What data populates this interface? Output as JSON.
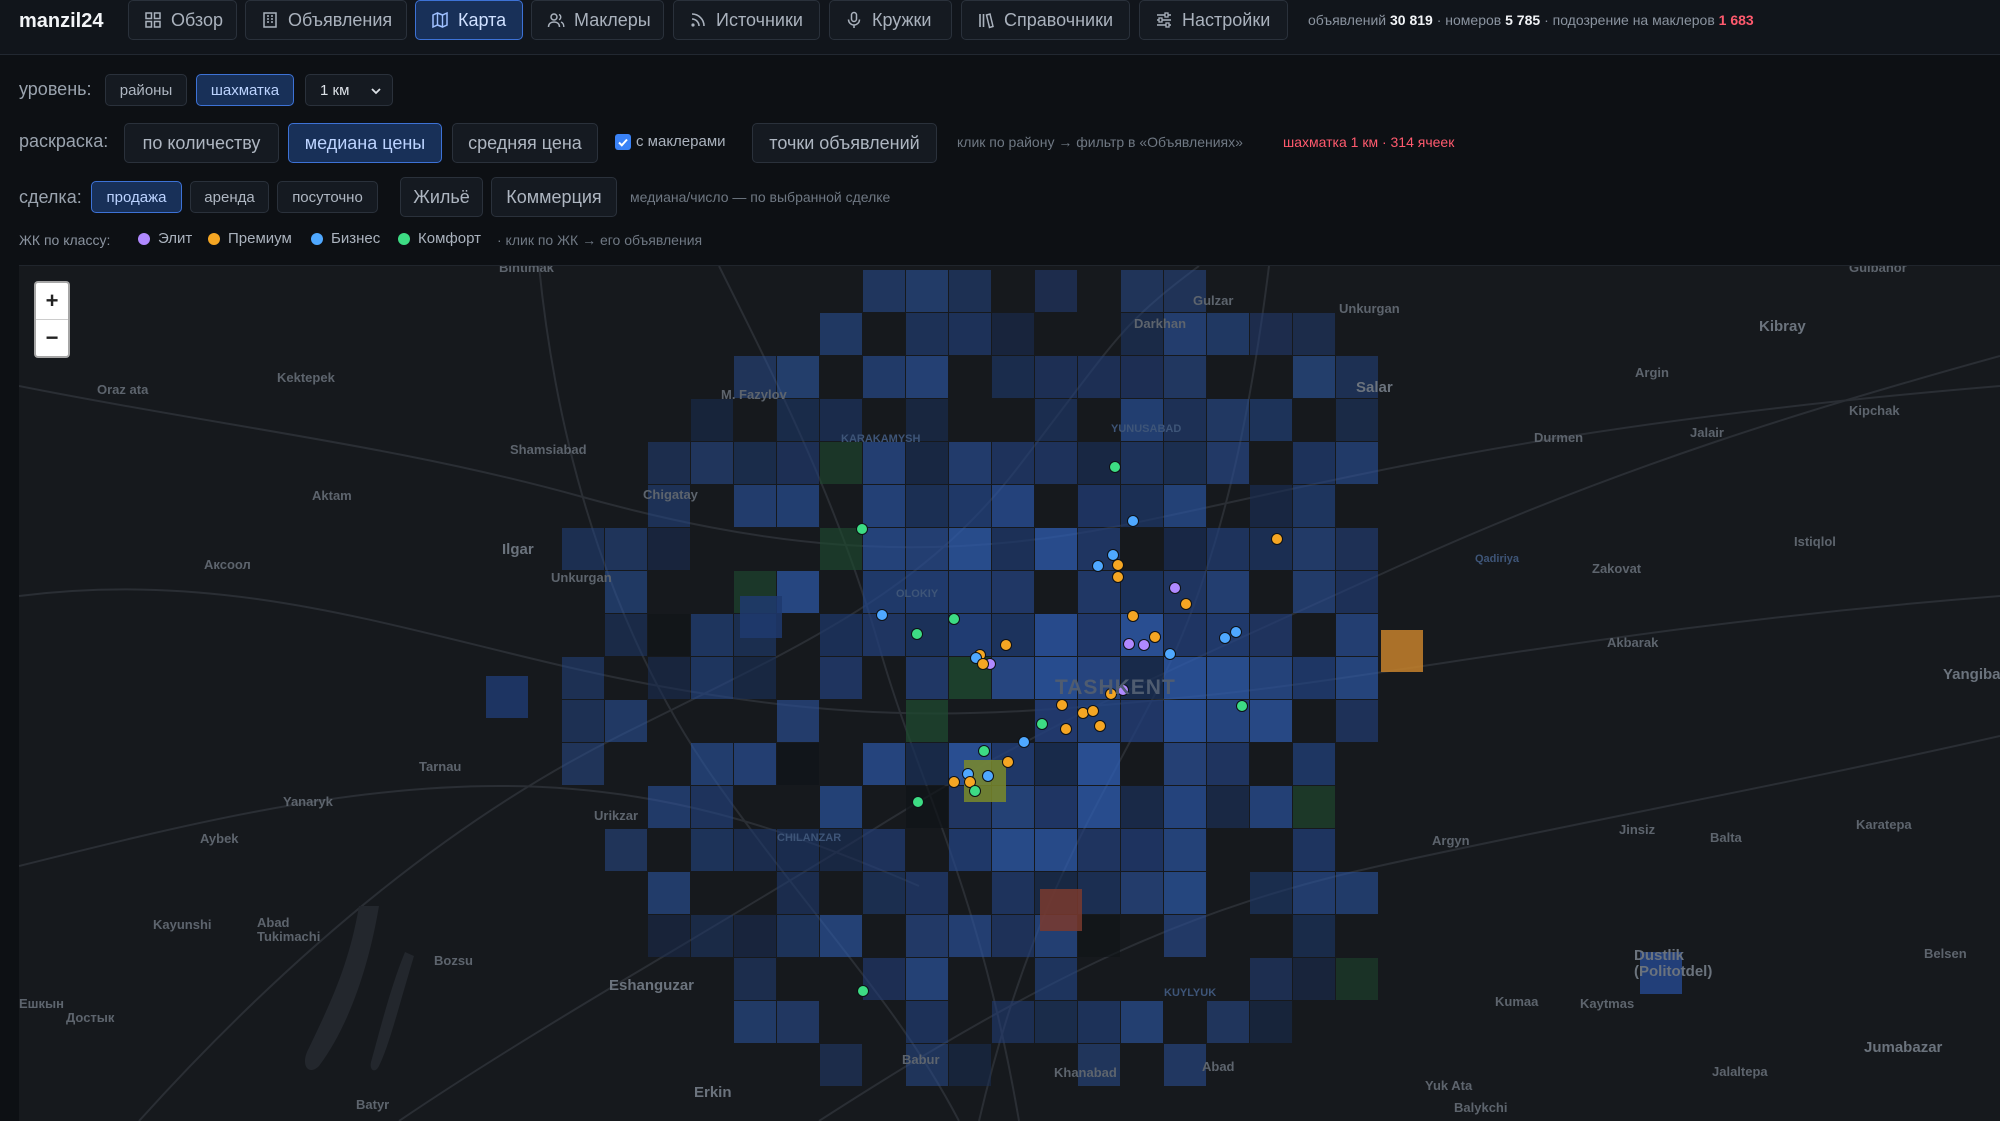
{
  "app": {
    "name": "manzil24"
  },
  "nav": [
    {
      "label": "Обзор",
      "icon": "grid-icon",
      "active": false
    },
    {
      "label": "Объявления",
      "icon": "building-icon",
      "active": false
    },
    {
      "label": "Карта",
      "icon": "map-icon",
      "active": true
    },
    {
      "label": "Маклеры",
      "icon": "users-icon",
      "active": false
    },
    {
      "label": "Источники",
      "icon": "rss-icon",
      "active": false
    },
    {
      "label": "Кружки",
      "icon": "mic-icon",
      "active": false
    },
    {
      "label": "Справочники",
      "icon": "library-icon",
      "active": false
    },
    {
      "label": "Настройки",
      "icon": "sliders-icon",
      "active": false
    }
  ],
  "stats": {
    "listings_label": "объявлений",
    "listings_value": "30 819",
    "phones_label": "· номеров",
    "phones_value": "5 785",
    "brokers_label": "· подозрение на маклеров",
    "brokers_value": "1 683"
  },
  "level": {
    "label": "уровень:",
    "options": [
      "районы",
      "шахматка"
    ],
    "selected": "шахматка",
    "cell_size": "1 км"
  },
  "coloring": {
    "label": "раскраска:",
    "options": [
      "по количеству",
      "медиана цены",
      "средняя цена"
    ],
    "selected": "медиана цены",
    "with_brokers_label": "с маклерами",
    "with_brokers_checked": true,
    "points_button": "точки объявлений",
    "hint": "клик по району → фильтр в «Объявлениях»",
    "grid_info": "шахматка 1 км · 314 ячеек"
  },
  "deal": {
    "label": "сделка:",
    "options": [
      "продажа",
      "аренда",
      "посуточно"
    ],
    "selected": "продажа",
    "types": [
      "Жильё",
      "Коммерция"
    ],
    "hint": "медиана/число — по выбранной сделке"
  },
  "complex_legend": {
    "label": "ЖК по классу:",
    "items": [
      {
        "label": "Элит",
        "color": "#b089ff"
      },
      {
        "label": "Премиум",
        "color": "#f5a623"
      },
      {
        "label": "Бизнес",
        "color": "#4fa8ff"
      },
      {
        "label": "Комфорт",
        "color": "#3ddc84"
      }
    ],
    "hint": "· клик по ЖК → его объявления"
  },
  "map": {
    "zoom_in": "+",
    "zoom_out": "−",
    "labels": [
      "Bintimak",
      "Gulzar",
      "Gulbahor",
      "Unkurgan",
      "Darkhan",
      "Kibray",
      "Kektepek",
      "M. Fazylov",
      "Salar",
      "Argin",
      "Kipchak",
      "Oraz ata",
      "Durmen",
      "Jalair",
      "Shamsiabad",
      "KARAKAMYSH",
      "YUNUSABAD",
      "Aktam",
      "Chigatay",
      "Istiqlol",
      "Ilgar",
      "Unkurgan",
      "Qadiriya",
      "Zakovat",
      "Аксоол",
      "OLOKIY",
      "Akbarak",
      "TASHKENT",
      "Yangiba",
      "Tarnau",
      "Yanaryk",
      "Urikzar",
      "CHILANZAR",
      "Jinsiz",
      "Balta",
      "Karatepa",
      "Aybek",
      "Argyn",
      "Kayunshi",
      "Abad Tukimachi",
      "Bozsu",
      "Belsen",
      "Dustlik (Politotdel)",
      "Eshanguzar",
      "KUYLYUK",
      "Kumaa",
      "Kaytmas",
      "Jumabazar",
      "Достык",
      "Babur",
      "Khanabad",
      "Abad",
      "Yuk Ata",
      "Jalaltepa",
      "Batyr",
      "Erkin",
      "Balykchi"
    ]
  }
}
